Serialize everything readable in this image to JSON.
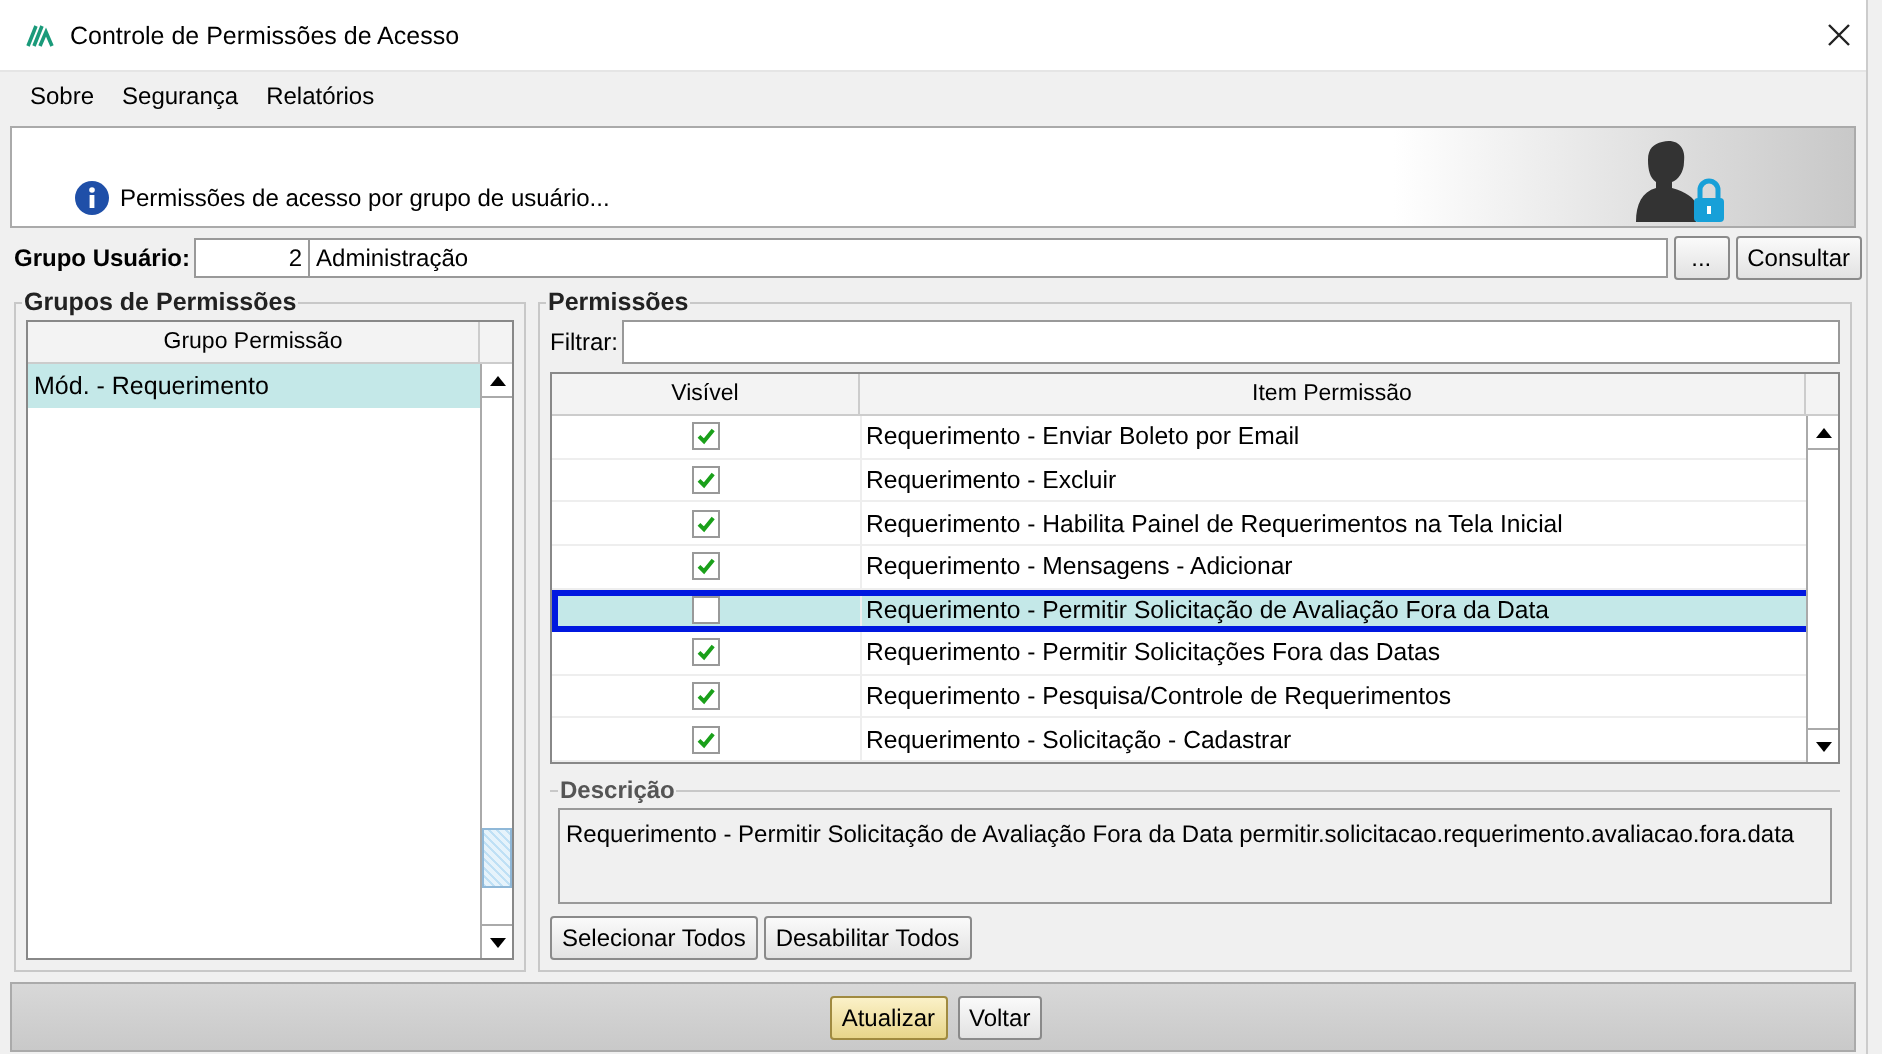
{
  "window": {
    "title": "Controle de Permissões de Acesso"
  },
  "menu": [
    "Sobre",
    "Segurança",
    "Relatórios"
  ],
  "banner": {
    "text": "Permissões de acesso por grupo de usuário..."
  },
  "user_group": {
    "label": "Grupo Usuário:",
    "code": "2",
    "name": "Administração",
    "browse_button": "...",
    "query_button": "Consultar"
  },
  "groups_panel": {
    "title": "Grupos de Permissões",
    "column": "Grupo Permissão",
    "rows": [
      {
        "label": "Mód. - Requerimento",
        "selected": true
      }
    ]
  },
  "permissions_panel": {
    "title": "Permissões",
    "filter_label": "Filtrar:",
    "columns": [
      "Visível",
      "Item Permissão"
    ],
    "rows": [
      {
        "visible": true,
        "item": "Requerimento - Enviar Boleto por Email",
        "selected": false
      },
      {
        "visible": true,
        "item": "Requerimento - Excluir",
        "selected": false
      },
      {
        "visible": true,
        "item": "Requerimento - Habilita Painel de Requerimentos na Tela Inicial",
        "selected": false
      },
      {
        "visible": true,
        "item": "Requerimento - Mensagens - Adicionar",
        "selected": false
      },
      {
        "visible": false,
        "item": "Requerimento - Permitir Solicitação de Avaliação Fora da Data",
        "selected": true
      },
      {
        "visible": true,
        "item": "Requerimento - Permitir Solicitações Fora das Datas",
        "selected": false
      },
      {
        "visible": true,
        "item": "Requerimento - Pesquisa/Controle de Requerimentos",
        "selected": false
      },
      {
        "visible": true,
        "item": "Requerimento - Solicitação - Cadastrar",
        "selected": false
      }
    ],
    "description_title": "Descrição",
    "description": "Requerimento - Permitir Solicitação de Avaliação Fora da Data permitir.solicitacao.requerimento.avaliacao.fora.data",
    "buttons": [
      "Selecionar Todos",
      "Desabilitar Todos"
    ]
  },
  "footer_buttons": [
    {
      "label": "Atualizar",
      "default": true
    },
    {
      "label": "Voltar",
      "default": false
    }
  ]
}
